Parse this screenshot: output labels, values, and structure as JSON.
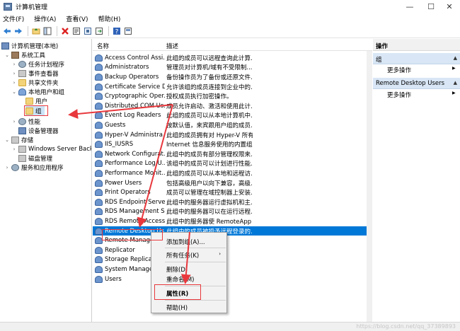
{
  "window": {
    "title": "计算机管理",
    "minimize_glyph": "—",
    "maximize_glyph": "☐",
    "close_glyph": "✕"
  },
  "menu": [
    "文件(F)",
    "操作(A)",
    "查看(V)",
    "帮助(H)"
  ],
  "toolbar_icons": [
    "back-icon",
    "forward-icon",
    "folder-up-icon",
    "show-tree-icon",
    "delete-icon",
    "properties-icon",
    "refresh-icon",
    "export-icon",
    "help-icon",
    "view-icon"
  ],
  "tree": {
    "root": "计算机管理(本地)",
    "system_tools": "系统工具",
    "task_scheduler": "任务计划程序",
    "event_viewer": "事件查看器",
    "shared_folders": "共享文件夹",
    "local_users_groups": "本地用户和组",
    "users": "用户",
    "groups": "组",
    "performance": "性能",
    "device_manager": "设备管理器",
    "storage": "存储",
    "windows_server_backup": "Windows Server Back",
    "disk_management": "磁盘管理",
    "services_apps": "服务和应用程序"
  },
  "list": {
    "col_name": "名称",
    "col_desc": "描述",
    "rows": [
      {
        "name": "Access Control Assi...",
        "desc": "此组的成员可以远程查询此计算..."
      },
      {
        "name": "Administrators",
        "desc": "管理员对计算机/域有不受限制..."
      },
      {
        "name": "Backup Operators",
        "desc": "备份操作员为了备份或还原文件..."
      },
      {
        "name": "Certificate Service D...",
        "desc": "允许该组的成员连接到企业中的..."
      },
      {
        "name": "Cryptographic Oper...",
        "desc": "授权成员执行加密操作。"
      },
      {
        "name": "Distributed COM Us...",
        "desc": "成员允许启动、激活和使用此计..."
      },
      {
        "name": "Event Log Readers",
        "desc": "此组的成员可以从本地计算机中..."
      },
      {
        "name": "Guests",
        "desc": "按默认值，来宾跟用户组的成员..."
      },
      {
        "name": "Hyper-V Administra...",
        "desc": "此组的成员拥有对 Hyper-V 所有..."
      },
      {
        "name": "IIS_IUSRS",
        "desc": "Internet 信息服务使用的内置组。"
      },
      {
        "name": "Network Configurat...",
        "desc": "此组中的成员有部分管理权限来..."
      },
      {
        "name": "Performance Log U...",
        "desc": "该组中的成员可以计划进行性能..."
      },
      {
        "name": "Performance Monit...",
        "desc": "此组的成员可以从本地和远程访..."
      },
      {
        "name": "Power Users",
        "desc": "包括高级用户以向下兼容，高级..."
      },
      {
        "name": "Print Operators",
        "desc": "成员可以管理在域控制器上安装..."
      },
      {
        "name": "RDS Endpoint Serve...",
        "desc": "此组中的服务器运行虚拟机和主..."
      },
      {
        "name": "RDS Management S...",
        "desc": "此组中的服务器可以在运行远程..."
      },
      {
        "name": "RDS Remote Access...",
        "desc": "此组中的服务器使 RemoteApp ..."
      },
      {
        "name": "Remote Desktop Us...",
        "desc": "此组中的成员被授予远程登录的..."
      },
      {
        "name": "Remote Manage...",
        "desc": "...资源的协议(例..."
      },
      {
        "name": "Replicator",
        "desc": ""
      },
      {
        "name": "Storage Replica ...",
        "desc": "...有功..."
      },
      {
        "name": "System Manage...",
        "desc": ""
      },
      {
        "name": "Users",
        "desc": "...的系统..."
      }
    ]
  },
  "context_menu": {
    "add_to_group": "添加到组(A)...",
    "all_tasks": "所有任务(K)",
    "all_tasks_arrow": "›",
    "delete": "删除(D)",
    "rename": "重命名(M)",
    "properties": "属性(R)",
    "help": "帮助(H)"
  },
  "actions": {
    "title": "操作",
    "section1": "组",
    "more1": "更多操作",
    "section2": "Remote Desktop Users",
    "more2": "更多操作",
    "arrow_glyph": "▲",
    "more_arrow_glyph": "▶"
  },
  "watermark": "https://blog.csdn.net/qq_37389893",
  "colors": {
    "selection": "#0078d7",
    "annotation_red": "#e8383d",
    "action_header": "#d8e6f5"
  }
}
